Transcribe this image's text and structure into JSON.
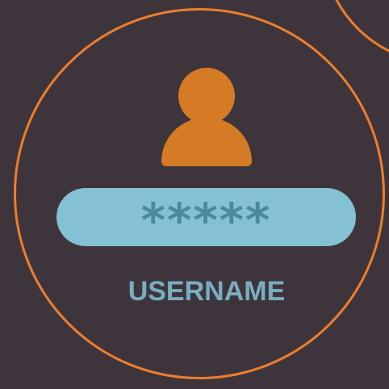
{
  "password": {
    "masked_value": "*****"
  },
  "label": {
    "text": "USERNAME"
  },
  "icons": {
    "user": "user-icon"
  },
  "colors": {
    "background": "#3e353c",
    "ring": "#ee7e2c",
    "user_icon": "#d67b25",
    "field": "#84c1d2",
    "mask_text": "#4a8a9b",
    "label_text": "#79adc0"
  }
}
